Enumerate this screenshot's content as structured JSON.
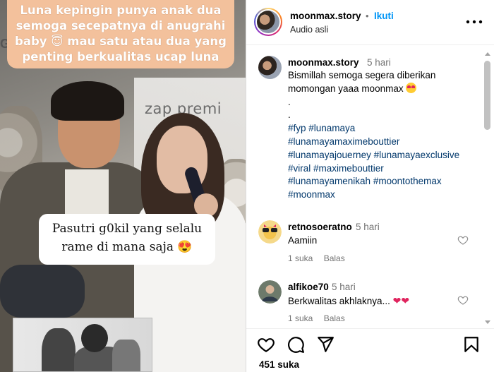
{
  "media": {
    "caption_top": "Luna kepingin punya anak dua semoga secepatnya di anugrahi baby 😇 mau satu atau dua yang penting berkualitas ucap luna",
    "caption_mid": "Pasutri g0kil yang selalu rame di mana saja 😍",
    "brand_text": "zap premi",
    "brand_left_text": "GY"
  },
  "header": {
    "username": "moonmax.story",
    "separator": "•",
    "follow_label": "Ikuti",
    "audio_label": "Audio asli"
  },
  "caption": {
    "username": "moonmax.story",
    "time": "5 hari",
    "line1": "Bismillah semoga segera diberikan",
    "line2": "momongan yaaa moonmax",
    "dot1": ".",
    "dot2": ".",
    "hashtags": [
      "#fyp #lunamaya",
      "#lunamayamaximebouttier",
      "#lunamayajouerney #lunamayaexclusive",
      "#viral #maximebouttier",
      "#lunamayamenikah #moontothemax",
      "#moonmax"
    ]
  },
  "comments": [
    {
      "username": "retnosoeratno",
      "time": "5 hari",
      "text": "Aamiin",
      "likes": "1 suka",
      "reply": "Balas"
    },
    {
      "username": "alfikoe70",
      "time": "5 hari",
      "text": "Berkwalitas akhlaknya...",
      "likes": "1 suka",
      "reply": "Balas"
    }
  ],
  "footer": {
    "likes": "451 suka"
  },
  "icons": {
    "more": "more-horizontal-icon",
    "like": "heart-icon",
    "comment": "comment-icon",
    "share": "send-icon",
    "save": "bookmark-icon"
  }
}
